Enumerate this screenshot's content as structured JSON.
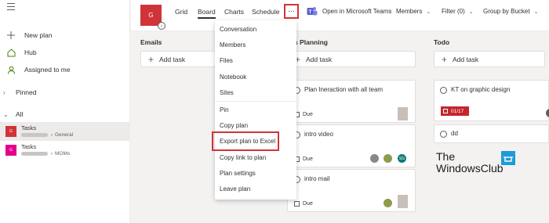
{
  "sidebar": {
    "nav": [
      {
        "label": "New plan",
        "icon": "plus-icon"
      },
      {
        "label": "Hub",
        "icon": "home-icon"
      },
      {
        "label": "Assigned to me",
        "icon": "person-icon"
      }
    ],
    "pinned_label": "Pinned",
    "all_label": "All",
    "plans": [
      {
        "name": "Tasks",
        "group": "General",
        "avatar": "G",
        "color": "#d13438"
      },
      {
        "name": "Tasks",
        "group": "MOMs",
        "avatar": "G",
        "color": "#e3008c"
      }
    ]
  },
  "topbar": {
    "plan_logo": "G",
    "info_icon": "i",
    "tabs": [
      "Grid",
      "Board",
      "Charts",
      "Schedule"
    ],
    "active_tab": "Board",
    "more_label": "···",
    "teams_label": "Open in Microsoft Teams",
    "members_label": "Members",
    "filter_label": "Filter (0)",
    "group_label": "Group by Bucket"
  },
  "menu": {
    "items": [
      "Conversation",
      "Members",
      "Files",
      "Notebook",
      "Sites",
      "Pin",
      "Copy plan",
      "Export plan to Excel",
      "Copy link to plan",
      "Plan settings",
      "Leave plan"
    ],
    "highlighted": "Export plan to Excel"
  },
  "board": {
    "add_task_label": "Add task",
    "buckets": [
      {
        "title": "Emails",
        "cards": []
      },
      {
        "title": "nts Planning",
        "cards": [
          {
            "title": "Plan Ineraction with all team",
            "due": "Due"
          },
          {
            "title": "intro video",
            "due": "Due",
            "avatar_initials": "SG"
          },
          {
            "title": "intro mail",
            "due": "Due"
          }
        ]
      },
      {
        "title": "Todo",
        "cards": [
          {
            "title": "KT on graphic design",
            "date": "01/17"
          },
          {
            "title": "dd"
          }
        ]
      }
    ]
  },
  "watermark": {
    "line1": "The",
    "line2": "WindowsClub"
  },
  "colors": {
    "accent_red": "#d13438",
    "magenta": "#e3008c",
    "teams_purple": "#5b5fc7",
    "date_red": "#c4262e"
  }
}
